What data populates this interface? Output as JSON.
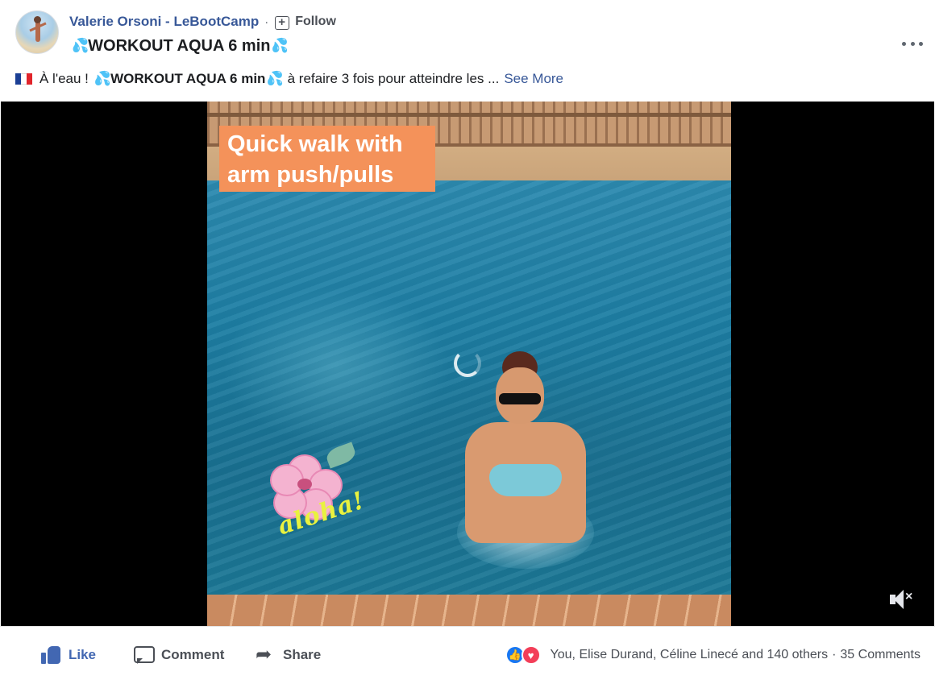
{
  "post": {
    "author": "Valerie Orsoni - LeBootCamp",
    "separator": "·",
    "follow_label": "Follow",
    "title_drops": "💦",
    "title": "WORKOUT AQUA 6 min",
    "desc_prefix": "À l'eau !",
    "desc_bold": "WORKOUT AQUA 6 min",
    "desc_rest": "à refaire 3 fois pour atteindre les ...",
    "see_more": "See More"
  },
  "video": {
    "caption": "Quick walk with arm push/pulls",
    "sticker_text": "aloha!",
    "mute_state": "muted"
  },
  "actions": {
    "like": "Like",
    "comment": "Comment",
    "share": "Share"
  },
  "engagement": {
    "reactors": "You, Elise Durand, Céline Linecé and 140 others",
    "separator": "·",
    "comments": "35 Comments"
  },
  "colors": {
    "link": "#385898",
    "like_blue": "#4267b2",
    "caption_bg": "#f4925a"
  }
}
